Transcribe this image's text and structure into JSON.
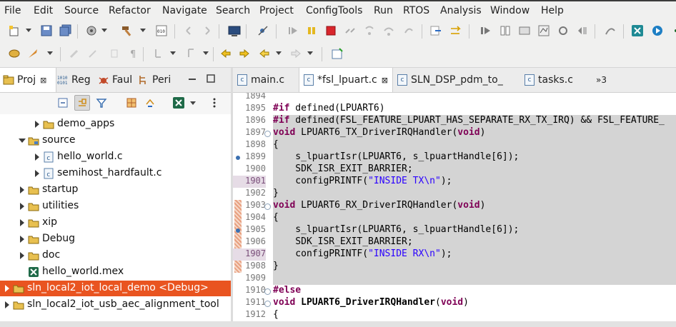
{
  "menu": [
    "File",
    "Edit",
    "Source",
    "Refactor",
    "Navigate",
    "Search",
    "Project",
    "ConfigTools",
    "Run",
    "RTOS",
    "Analysis",
    "Window",
    "Help"
  ],
  "left_tabs": [
    {
      "label": "Proj",
      "icon": "project-explorer-icon",
      "close": "⊠"
    },
    {
      "label": "Reg",
      "icon": "registers-icon"
    },
    {
      "label": "Faul",
      "icon": "fault-analyzer-icon"
    },
    {
      "label": "Peri",
      "icon": "peripherals-icon"
    }
  ],
  "tree": [
    {
      "label": "demo_apps",
      "icon": "folder-icon",
      "indent": 2,
      "expand": "collapsed"
    },
    {
      "label": "source",
      "icon": "source-folder-icon",
      "indent": 1,
      "expand": "expanded"
    },
    {
      "label": "hello_world.c",
      "icon": "c-file-icon",
      "indent": 2,
      "expand": "collapsed"
    },
    {
      "label": "semihost_hardfault.c",
      "icon": "c-file-icon",
      "indent": 2,
      "expand": "collapsed"
    },
    {
      "label": "startup",
      "icon": "folder-icon",
      "indent": 1,
      "expand": "collapsed"
    },
    {
      "label": "utilities",
      "icon": "folder-icon",
      "indent": 1,
      "expand": "collapsed"
    },
    {
      "label": "xip",
      "icon": "folder-icon",
      "indent": 1,
      "expand": "collapsed"
    },
    {
      "label": "Debug",
      "icon": "folder-icon",
      "indent": 1,
      "expand": "collapsed"
    },
    {
      "label": "doc",
      "icon": "folder-icon",
      "indent": 1,
      "expand": "collapsed"
    },
    {
      "label": "hello_world.mex",
      "icon": "mex-file-icon",
      "indent": 1,
      "expand": "none"
    },
    {
      "label": "sln_local2_iot_local_demo <Debug>",
      "icon": "project-icon",
      "indent": 0,
      "expand": "collapsed",
      "selected": true
    },
    {
      "label": "sln_local2_iot_usb_aec_alignment_tool",
      "icon": "project-icon",
      "indent": 0,
      "expand": "collapsed"
    }
  ],
  "editor_tabs": [
    {
      "label": "main.c",
      "active": false
    },
    {
      "label": "*fsl_lpuart.c",
      "active": true,
      "close": "⊠"
    },
    {
      "label": "SLN_DSP_pdm_to_",
      "active": false
    },
    {
      "label": "tasks.c",
      "active": false
    }
  ],
  "editor_overflow": "»3",
  "code_lines": [
    {
      "n": "1894",
      "parts": [
        {
          "t": ""
        }
      ]
    },
    {
      "n": "1895",
      "parts": [
        {
          "t": "#if",
          "c": "kw"
        },
        {
          "t": " defined(LPUART6)"
        }
      ]
    },
    {
      "n": "1896",
      "grey": true,
      "parts": [
        {
          "t": "#if",
          "c": "kw"
        },
        {
          "t": " defined(FSL_FEATURE_LPUART_HAS_SEPARATE_RX_TX_IRQ) && FSL_FEATURE_"
        }
      ]
    },
    {
      "n": "1897",
      "grey": true,
      "fold": true,
      "parts": [
        {
          "t": "void",
          "c": "kw"
        },
        {
          "t": " LPUART6_TX_DriverIRQHandler("
        },
        {
          "t": "void",
          "c": "kw"
        },
        {
          "t": ")"
        }
      ]
    },
    {
      "n": "1898",
      "grey": true,
      "parts": [
        {
          "t": "{"
        }
      ]
    },
    {
      "n": "1899",
      "grey": true,
      "marker": true,
      "parts": [
        {
          "t": "    s_lpuartIsr(LPUART6, s_lpuartHandle[6]);"
        }
      ]
    },
    {
      "n": "1900",
      "grey": true,
      "parts": [
        {
          "t": "    SDK_ISR_EXIT_BARRIER;"
        }
      ]
    },
    {
      "n": "1901",
      "grey": true,
      "hl": true,
      "parts": [
        {
          "t": "    configPRINTF("
        },
        {
          "t": "\"INSIDE TX\\n\"",
          "c": "str"
        },
        {
          "t": ");"
        }
      ]
    },
    {
      "n": "1902",
      "grey": true,
      "parts": [
        {
          "t": "}"
        }
      ]
    },
    {
      "n": "1903",
      "grey": true,
      "fold": true,
      "changed": true,
      "parts": [
        {
          "t": "void",
          "c": "kw"
        },
        {
          "t": " LPUART6_RX_DriverIRQHandler("
        },
        {
          "t": "void",
          "c": "kw"
        },
        {
          "t": ")"
        }
      ]
    },
    {
      "n": "1904",
      "grey": true,
      "changed": true,
      "parts": [
        {
          "t": "{"
        }
      ]
    },
    {
      "n": "1905",
      "grey": true,
      "changed": true,
      "marker": true,
      "parts": [
        {
          "t": "    s_lpuartIsr(LPUART6, s_lpuartHandle[6]);"
        }
      ]
    },
    {
      "n": "1906",
      "grey": true,
      "changed": true,
      "parts": [
        {
          "t": "    SDK_ISR_EXIT_BARRIER;"
        }
      ]
    },
    {
      "n": "1907",
      "grey": true,
      "changed": true,
      "hl": true,
      "parts": [
        {
          "t": "    configPRINTF("
        },
        {
          "t": "\"INSIDE RX\\n\"",
          "c": "str"
        },
        {
          "t": ");"
        }
      ]
    },
    {
      "n": "1908",
      "grey": true,
      "changed": true,
      "parts": [
        {
          "t": "}"
        }
      ]
    },
    {
      "n": "1909",
      "grey": true,
      "parts": [
        {
          "t": ""
        }
      ]
    },
    {
      "n": "1910",
      "fold": true,
      "parts": [
        {
          "t": "#else",
          "c": "kw"
        }
      ]
    },
    {
      "n": "1911",
      "fold": true,
      "parts": [
        {
          "t": "void",
          "c": "kw"
        },
        {
          "t": " "
        },
        {
          "t": "LPUART6_DriverIRQHandler",
          "c": "fn-bold"
        },
        {
          "t": "("
        },
        {
          "t": "void",
          "c": "kw"
        },
        {
          "t": ")"
        }
      ]
    },
    {
      "n": "1912",
      "parts": [
        {
          "t": "{"
        }
      ]
    }
  ],
  "colors": {
    "selection": "#e95420",
    "keyword": "#7f0055",
    "string": "#2a00ff",
    "inactive_code_bg": "#d4d4d4"
  }
}
